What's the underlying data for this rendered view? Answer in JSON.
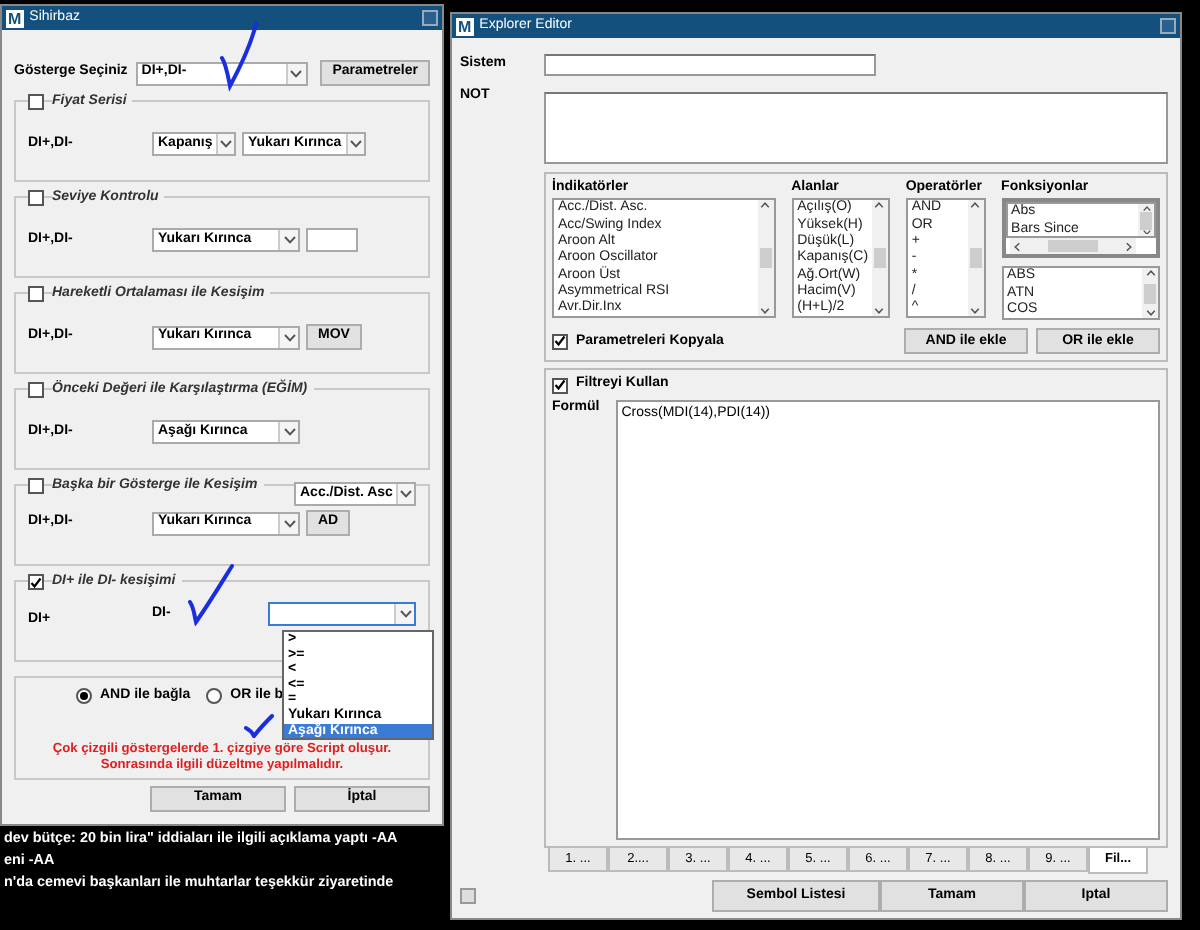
{
  "wizard": {
    "icon_letter": "M",
    "title": "Sihirbaz",
    "indicator_label": "Gösterge Seçiniz",
    "indicator_value": "DI+,DI-",
    "parameters_button": "Parametreler",
    "groups": [
      {
        "title": "Fiyat Serisi",
        "checked": false,
        "label": "DI+,DI-",
        "controls": [
          {
            "kind": "select",
            "value": "Kapanış"
          },
          {
            "kind": "select",
            "value": "Yukarı Kırınca"
          }
        ]
      },
      {
        "title": "Seviye Kontrolu",
        "checked": false,
        "label": "DI+,DI-",
        "controls": [
          {
            "kind": "select",
            "value": "Yukarı Kırınca"
          },
          {
            "kind": "input"
          }
        ]
      },
      {
        "title": "Hareketli Ortalaması ile Kesişim",
        "checked": false,
        "label": "DI+,DI-",
        "controls": [
          {
            "kind": "select",
            "value": "Yukarı Kırınca"
          },
          {
            "kind": "button",
            "value": "MOV"
          }
        ]
      },
      {
        "title": "Önceki Değeri ile Karşılaştırma (EĞİM)",
        "checked": false,
        "label": "DI+,DI-",
        "controls": [
          {
            "kind": "select",
            "value": "Aşağı Kırınca"
          }
        ]
      },
      {
        "title": "Başka bir Gösterge ile Kesişim",
        "checked": false,
        "header_select": "Acc./Dist. Asc",
        "label": "DI+,DI-",
        "controls": [
          {
            "kind": "select",
            "value": "Yukarı Kırınca"
          },
          {
            "kind": "button",
            "value": "AD"
          }
        ]
      },
      {
        "title": "DI+ ile DI- kesişimi",
        "checked": true,
        "label": "DI+",
        "controls": [
          {
            "kind": "text",
            "value": "DI-"
          },
          {
            "kind": "select",
            "expanded": true,
            "options": [
              {
                "label": ">",
                "selected": false
              },
              {
                "label": ">=",
                "selected": false
              },
              {
                "label": "<",
                "selected": false
              },
              {
                "label": "<=",
                "selected": false
              },
              {
                "label": "=",
                "selected": false
              },
              {
                "label": "Yukarı Kırınca",
                "selected": false
              },
              {
                "label": "Aşağı Kırınca",
                "selected": true
              }
            ]
          }
        ]
      }
    ],
    "connect": [
      {
        "label": "AND ile bağla",
        "selected": true
      },
      {
        "label": "OR ile b",
        "selected": false
      }
    ],
    "warning": [
      "Çok çizgili göstergelerde 1. çizgiye göre Script oluşur.",
      "Sonrasında ilgili düzeltme yapılmalıdır."
    ],
    "buttons": [
      "Tamam",
      "İptal"
    ]
  },
  "explorer": {
    "icon_letter": "M",
    "title": "Explorer Editor",
    "system_label": "Sistem",
    "note_label": "NOT",
    "lists": [
      {
        "title": "İndikatörler",
        "items": [
          "Acc./Dist. Asc.",
          "Acc/Swing Index",
          "Aroon Alt",
          "Aroon Oscillator",
          "Aroon Üst",
          "Asymmetrical RSI",
          "Avr.Dir.Inx"
        ]
      },
      {
        "title": "Alanlar",
        "items": [
          "Açılış(O)",
          "Yüksek(H)",
          "Düşük(L)",
          "Kapanış(C)",
          "Ağ.Ort(W)",
          "Hacim(V)",
          "(H+L)/2"
        ]
      },
      {
        "title": "Operatörler",
        "items": [
          "AND",
          "OR",
          "+",
          "-",
          "*",
          "/",
          "^"
        ]
      }
    ],
    "functions": {
      "title": "Fonksiyonlar",
      "groups": [
        "Abs",
        "Bars Since"
      ],
      "items": [
        "ABS",
        "ATN",
        "COS"
      ]
    },
    "copy_params": {
      "label": "Parametreleri Kopyala",
      "checked": true
    },
    "add_buttons": [
      "AND ile ekle",
      "OR ile ekle"
    ],
    "filter": {
      "label": "Filtreyi Kullan",
      "checked": true
    },
    "formula_label": "Formül",
    "formula": "Cross(MDI(14),PDI(14))",
    "tabs": [
      {
        "label": "1. ...",
        "selected": false
      },
      {
        "label": "2....",
        "selected": false
      },
      {
        "label": "3. ...",
        "selected": false
      },
      {
        "label": "4. ...",
        "selected": false
      },
      {
        "label": "5. ...",
        "selected": false
      },
      {
        "label": "6. ...",
        "selected": false
      },
      {
        "label": "7. ...",
        "selected": false
      },
      {
        "label": "8. ...",
        "selected": false
      },
      {
        "label": "9. ...",
        "selected": false
      },
      {
        "label": "Fil...",
        "selected": true
      }
    ],
    "buttons": [
      "Sembol Listesi",
      "Tamam",
      "Iptal"
    ]
  },
  "news": [
    "dev bütçe: 20 bin lira\" iddiaları ile ilgili açıklama yaptı -AA",
    "eni -AA",
    "n'da cemevi başkanları ile muhtarlar teşekkür ziyaretinde"
  ]
}
